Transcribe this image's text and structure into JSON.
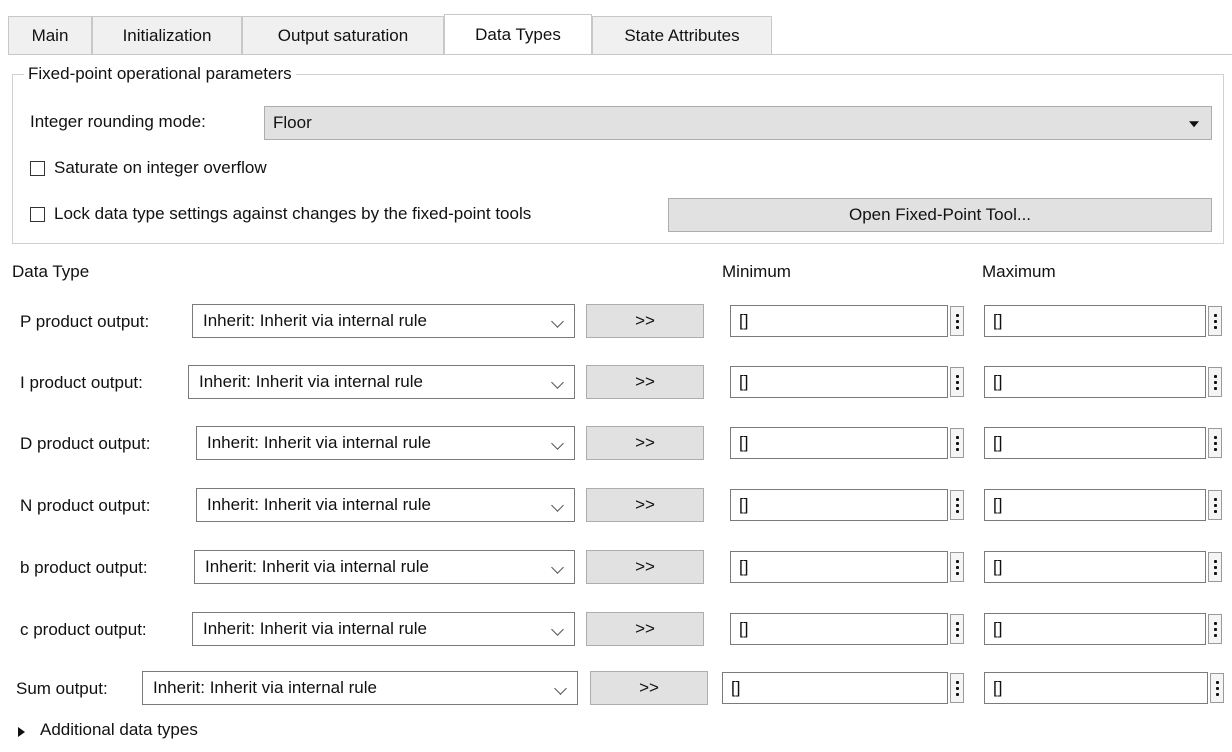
{
  "tabs": [
    "Main",
    "Initialization",
    "Output saturation",
    "Data Types",
    "State Attributes"
  ],
  "active_tab": "Data Types",
  "fixed_point": {
    "group_title": "Fixed-point operational parameters",
    "rounding_label": "Integer rounding mode:",
    "rounding_value": "Floor",
    "saturate_label": "Saturate on integer overflow",
    "saturate_checked": false,
    "lock_label": "Lock data type settings against changes by the fixed-point tools",
    "lock_checked": false,
    "open_tool_button": "Open Fixed-Point Tool..."
  },
  "columns": {
    "data_type": "Data Type",
    "minimum": "Minimum",
    "maximum": "Maximum"
  },
  "rows": [
    {
      "label": "P product output:",
      "type": "Inherit: Inherit via internal rule",
      "assistant": ">>",
      "min": "[]",
      "max": "[]"
    },
    {
      "label": "I product output:",
      "type": "Inherit: Inherit via internal rule",
      "assistant": ">>",
      "min": "[]",
      "max": "[]"
    },
    {
      "label": "D product output:",
      "type": "Inherit: Inherit via internal rule",
      "assistant": ">>",
      "min": "[]",
      "max": "[]"
    },
    {
      "label": "N product output:",
      "type": "Inherit: Inherit via internal rule",
      "assistant": ">>",
      "min": "[]",
      "max": "[]"
    },
    {
      "label": "b product output:",
      "type": "Inherit: Inherit via internal rule",
      "assistant": ">>",
      "min": "[]",
      "max": "[]"
    },
    {
      "label": "c product output:",
      "type": "Inherit: Inherit via internal rule",
      "assistant": ">>",
      "min": "[]",
      "max": "[]"
    },
    {
      "label": "Sum output:",
      "type": "Inherit: Inherit via internal rule",
      "assistant": ">>",
      "min": "[]",
      "max": "[]"
    }
  ],
  "additional_label": "Additional data types"
}
